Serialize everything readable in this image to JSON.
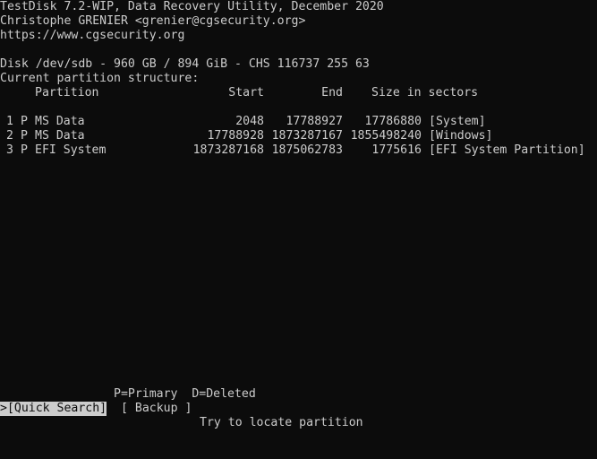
{
  "header": {
    "line1": "TestDisk 7.2-WIP, Data Recovery Utility, December 2020",
    "line2": "Christophe GRENIER <grenier@cgsecurity.org>",
    "line3": "https://www.cgsecurity.org"
  },
  "disk": {
    "info": "Disk /dev/sdb - 960 GB / 894 GiB - CHS 116737 255 63",
    "structure_label": "Current partition structure:"
  },
  "table": {
    "columns": {
      "partition": "Partition",
      "start": "Start",
      "end": "End",
      "size": "Size in sectors"
    },
    "rows": [
      {
        "num": "1",
        "type": "P",
        "name": "MS Data",
        "start": "2048",
        "end": "17788927",
        "size": "17786880",
        "label": "[System]"
      },
      {
        "num": "2",
        "type": "P",
        "name": "MS Data",
        "start": "17788928",
        "end": "1873287167",
        "size": "1855498240",
        "label": "[Windows]"
      },
      {
        "num": "3",
        "type": "P",
        "name": "EFI System",
        "start": "1873287168",
        "end": "1875062783",
        "size": "1775616",
        "label": "[EFI System Partition]"
      }
    ]
  },
  "footer": {
    "legend": "P=Primary  D=Deleted",
    "quick_search_label": ">[Quick Search]",
    "backup_label": "[ Backup ]",
    "hint": "Try to locate partition"
  }
}
